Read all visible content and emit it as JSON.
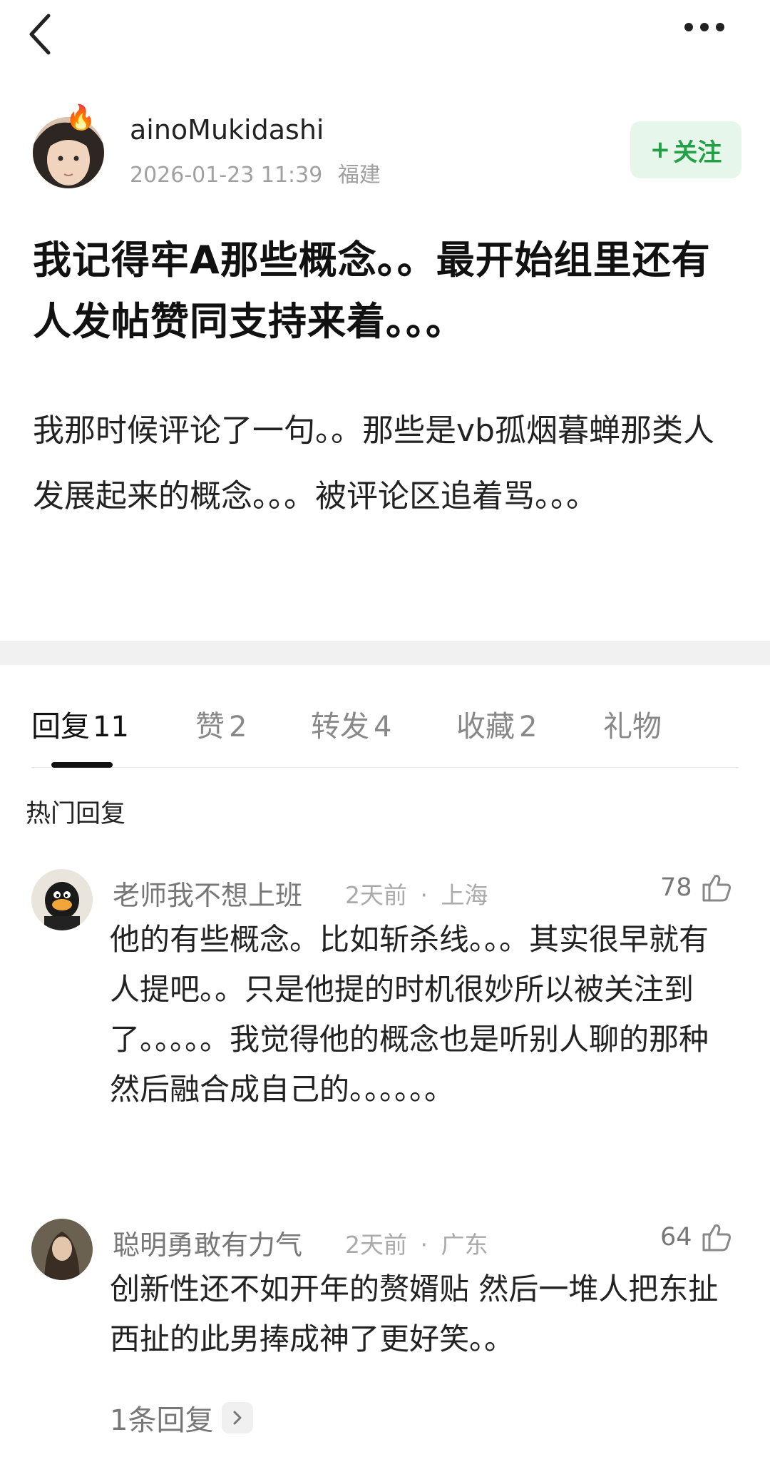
{
  "author": {
    "name": "ainoMukidashi",
    "timestamp": "2026-01-23 11:39",
    "location": "福建",
    "follow_label": "关注",
    "follow_plus": "+"
  },
  "post": {
    "title": "我记得牢A那些概念。。最开始组里还有人发帖赞同支持来着。。。",
    "body": "我那时候评论了一句。。那些是vb孤烟暮蝉那类人发展起来的概念。。。被评论区追着骂。。。"
  },
  "tabs": [
    {
      "label": "回复",
      "count": "11"
    },
    {
      "label": "赞",
      "count": "2"
    },
    {
      "label": "转发",
      "count": "4"
    },
    {
      "label": "收藏",
      "count": "2"
    },
    {
      "label": "礼物",
      "count": ""
    }
  ],
  "hot_replies_title": "热门回复",
  "comments": [
    {
      "name": "老师我不想上班",
      "time": "2天前",
      "location": "上海",
      "likes": "78",
      "text": "他的有些概念。比如斩杀线。。。其实很早就有人提吧。。只是他提的时机很妙所以被关注到了。。。。。我觉得他的概念也是听别人聊的那种然后融合成自己的。。。。。。"
    },
    {
      "name": "聪明勇敢有力气",
      "time": "2天前",
      "location": "广东",
      "likes": "64",
      "text": "创新性还不如开年的赘婿贴 然后一堆人把东扯西扯的此男捧成神了更好笑。。"
    }
  ],
  "reply_count_label": "1条回复",
  "colors": {
    "accent_green": "#24a147",
    "follow_bg": "#e6f6ea",
    "meta_gray": "#a0a0a0"
  },
  "icons": [
    "back-arrow-icon",
    "more-dots-icon",
    "fire-icon",
    "thumb-up-icon",
    "chevron-right-icon"
  ]
}
